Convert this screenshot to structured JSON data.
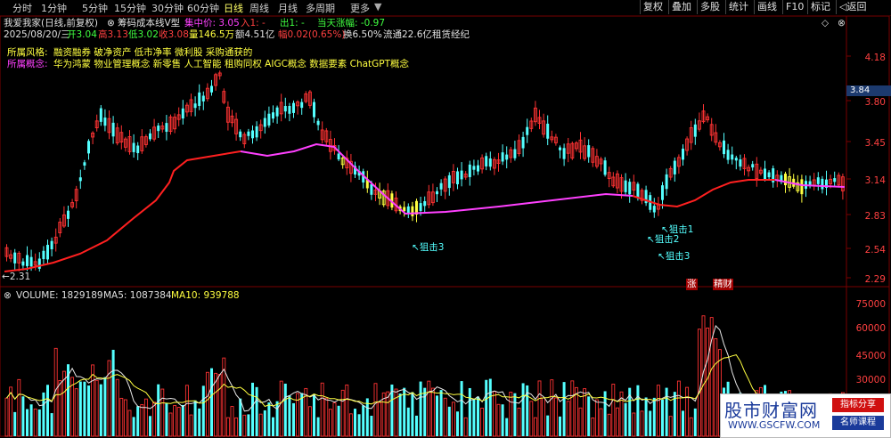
{
  "tabs": [
    "分时",
    "1分钟",
    "5分钟",
    "15分钟",
    "30分钟",
    "60分钟",
    "日线",
    "周线",
    "月线",
    "多周期",
    "更多"
  ],
  "active_tab": "日线",
  "right_buttons": [
    "复权",
    "叠加",
    "多股",
    "统计",
    "画线",
    "F10",
    "标记",
    "◁返回"
  ],
  "header": {
    "stock_name": "我爱我家(日线,前复权)",
    "indicator": "筹码成本线V型",
    "indicator_values": [
      "集中价: 3.05",
      "入1: -",
      "出1: -",
      "当天涨幅: -0.97"
    ],
    "row2": [
      "2025/08/20/三",
      "开3.04",
      "高3.13",
      "低3.02",
      "收3.08",
      "量146.5万",
      "额4.51亿",
      "幅0.02(0.65%)",
      "换6.50%",
      "流通22.6亿",
      "租赁经纪"
    ],
    "style_label": "所属风格:",
    "style_value": "融资融券 破净资产 低市净率 微利股 采购通获的",
    "concept_label": "所属概念:",
    "concept_value": "华为鸿蒙 物业管理概念 新零售 人工智能 租购同权 AIGC概念 数据要素 ChatGPT概念"
  },
  "price_axis": [
    "4.18",
    "3.80",
    "3.45",
    "3.14",
    "2.83",
    "2.54",
    "2.29"
  ],
  "price_tag": "3.84",
  "min_label": "2.31",
  "annotations": {
    "zuji3": "狙击3",
    "z1": "狙击1",
    "z2": "狙击2",
    "z3": "狙击3",
    "zhang": "涨",
    "jincai": "精财"
  },
  "volume_header": {
    "volume": "VOLUME: 1829189",
    "ma5": "MA5: 1087384",
    "ma10": "MA10: 939788"
  },
  "volume_axis": [
    "75000",
    "60000",
    "45000",
    "30000"
  ],
  "logo": {
    "title": "股市财富网",
    "url": "WWW.GSCFW.COM",
    "tag1": "指标分享",
    "tag2": "名师课程"
  },
  "colors": {
    "up": "#ff3333",
    "down": "#54ffff",
    "ma_red": "#ff2020",
    "ma_magenta": "#ff40ff",
    "ma_yellow": "#ffff40",
    "axis": "#ff4040"
  }
}
